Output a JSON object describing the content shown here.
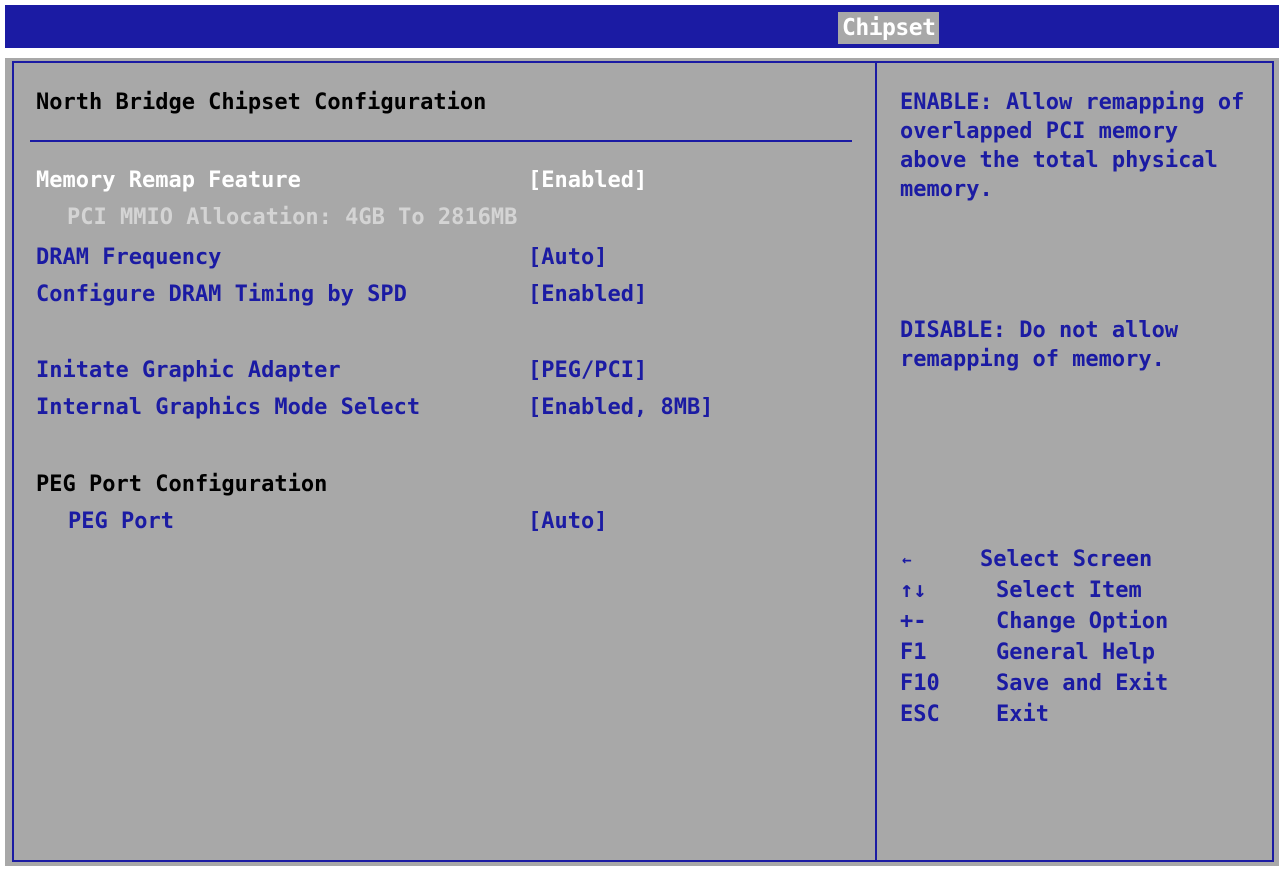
{
  "header": {
    "active_tab": "Chipset"
  },
  "main": {
    "section_title": "North Bridge Chipset Configuration",
    "settings": [
      {
        "label": "Memory Remap Feature",
        "value": "[Enabled]"
      },
      {
        "info": "PCI MMIO Allocation: 4GB To 2816MB"
      },
      {
        "label": "DRAM Frequency",
        "value": "[Auto]"
      },
      {
        "label": "Configure DRAM Timing by SPD",
        "value": "[Enabled]"
      },
      {
        "label": "Initate Graphic Adapter",
        "value": "[PEG/PCI]"
      },
      {
        "label": "Internal Graphics Mode Select",
        "value": "[Enabled, 8MB]"
      },
      {
        "heading": "PEG Port Configuration"
      },
      {
        "label": "PEG Port",
        "value": "[Auto]"
      }
    ]
  },
  "help": {
    "enable_text": "ENABLE: Allow remapping of overlapped PCI memory above the total physical memory.",
    "disable_text": "DISABLE: Do not allow remapping of memory."
  },
  "keys": [
    {
      "key": "←",
      "desc": "Select Screen",
      "icon": "left-arrow-icon"
    },
    {
      "key": "↑↓",
      "desc": "Select Item",
      "icon": "up-down-arrow-icon"
    },
    {
      "key": "+-",
      "desc": "Change Option",
      "icon": "plus-minus-icon"
    },
    {
      "key": "F1",
      "desc": "General Help"
    },
    {
      "key": "F10",
      "desc": "Save and Exit"
    },
    {
      "key": "ESC",
      "desc": "Exit"
    }
  ],
  "colors": {
    "bar_blue": "#1b1ba3",
    "panel_gray": "#a8a8a8",
    "selected_text": "#ffffff",
    "info_text": "#d4d4d4"
  }
}
